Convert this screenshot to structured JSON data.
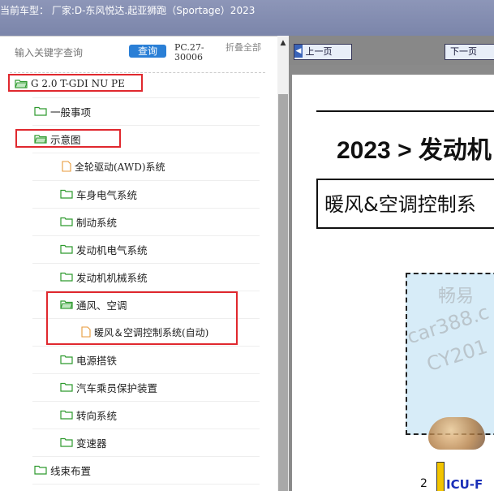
{
  "title_bar": {
    "text": "当前车型：  厂家:D-东风悦达.起亚狮跑（Sportage）2023"
  },
  "sidebar": {
    "search_placeholder": "输入关键字查询",
    "query_label": "查询",
    "pc_code": "PC.27-30006",
    "collapse_label": "折叠全部",
    "items": [
      {
        "label": "G 2.0 T-GDI NU PE",
        "icon": "folder-open-icon"
      },
      {
        "label": "一般事项",
        "icon": "folder-icon"
      },
      {
        "label": "示意图",
        "icon": "folder-open-icon"
      },
      {
        "label": "全轮驱动(AWD)系统",
        "icon": "file-icon"
      },
      {
        "label": "车身电气系统",
        "icon": "folder-icon"
      },
      {
        "label": "制动系统",
        "icon": "folder-icon"
      },
      {
        "label": "发动机电气系统",
        "icon": "folder-icon"
      },
      {
        "label": "发动机机械系统",
        "icon": "folder-icon"
      },
      {
        "label": "通风、空调",
        "icon": "folder-open-icon"
      },
      {
        "label": "暖风＆空调控制系统(自动)",
        "icon": "file-icon"
      },
      {
        "label": "电源搭铁",
        "icon": "folder-icon"
      },
      {
        "label": "汽车乘员保护装置",
        "icon": "folder-icon"
      },
      {
        "label": "转向系统",
        "icon": "folder-icon"
      },
      {
        "label": "变速器",
        "icon": "folder-icon"
      },
      {
        "label": "线束布置",
        "icon": "folder-icon"
      }
    ]
  },
  "viewer": {
    "prev_label": "上一页",
    "next_label": "下一页",
    "doc_heading": "2023 > 发动机",
    "doc_subtitle": "暖风&空调控制系",
    "watermark_1": "畅易",
    "watermark_2": "car388.c",
    "watermark_3": "CY201",
    "pin_number": "2",
    "connector_label": "ICU-F"
  },
  "colors": {
    "title_bar": "#8790b2",
    "query_button": "#2a7fd6",
    "highlight_box": "#e0282e",
    "folder_green": "#2e9a2e",
    "file_orange": "#e89a3a",
    "diagram_fill": "#d7ecf8",
    "connector_yellow": "#f2c400",
    "connector_label": "#1a2fb8"
  }
}
